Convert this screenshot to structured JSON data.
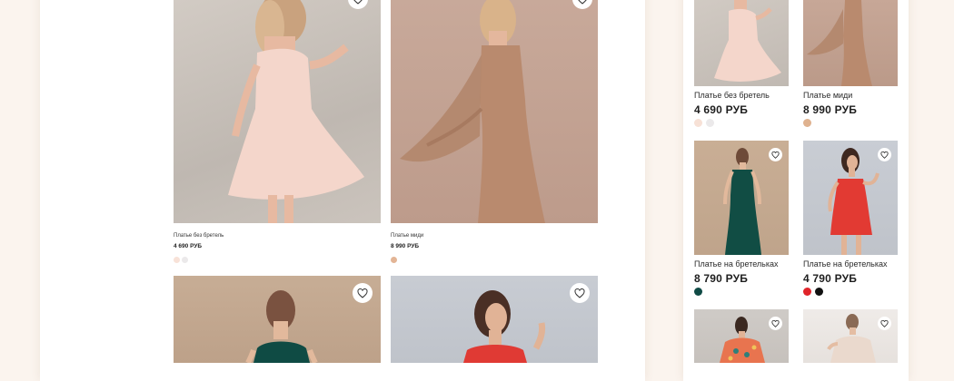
{
  "catalog_large": {
    "products": [
      {
        "name": "Платье без бретель",
        "price": "4 690 РУБ",
        "colors": [
          "#f8e2d8",
          "#ebe9ea"
        ]
      },
      {
        "name": "Платье миди",
        "price": "8 990 РУБ",
        "colors": [
          "#e3b596"
        ]
      },
      {
        "name": "",
        "price": "",
        "colors": []
      },
      {
        "name": "",
        "price": "",
        "colors": []
      }
    ]
  },
  "catalog_small": {
    "products": [
      {
        "name": "Платье без бретель",
        "price": "4 690 РУБ",
        "colors": [
          "#f7e1d6",
          "#ebe9ea"
        ]
      },
      {
        "name": "Платье миди",
        "price": "8 990 РУБ",
        "colors": [
          "#dfb28f"
        ]
      },
      {
        "name": "Платье на бретельках",
        "price": "8 790 РУБ",
        "colors": [
          "#0f4a45"
        ]
      },
      {
        "name": "Платье на бретельках",
        "price": "4 790 РУБ",
        "colors": [
          "#e0242a",
          "#111111"
        ]
      },
      {
        "name": "",
        "price": "",
        "colors": []
      },
      {
        "name": "",
        "price": "",
        "colors": []
      }
    ]
  },
  "icons": {
    "favorite": "heart-icon"
  }
}
